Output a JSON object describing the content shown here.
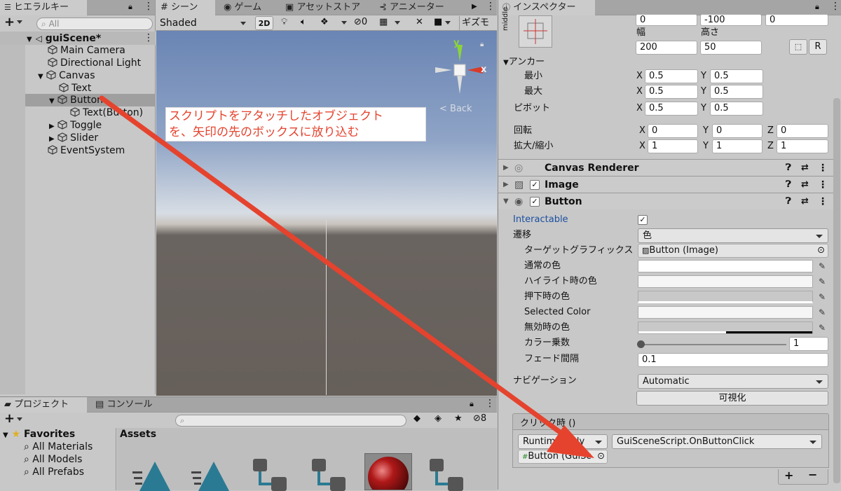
{
  "hierarchy": {
    "tab_label": "ヒエラルキー",
    "search_placeholder": "All",
    "items": [
      {
        "label": "guiScene*"
      },
      {
        "label": "Main Camera"
      },
      {
        "label": "Directional Light"
      },
      {
        "label": "Canvas"
      },
      {
        "label": "Text"
      },
      {
        "label": "Button"
      },
      {
        "label": "Text(Button)"
      },
      {
        "label": "Toggle"
      },
      {
        "label": "Slider"
      },
      {
        "label": "EventSystem"
      }
    ]
  },
  "scene": {
    "tabs": [
      {
        "label": "シーン"
      },
      {
        "label": "ゲーム"
      },
      {
        "label": "アセットストア"
      },
      {
        "label": "アニメーター"
      }
    ],
    "shading_mode": "Shaded",
    "mode_2d": "2D",
    "hidden_count": "0",
    "gizmos_label": "ギズモ",
    "gizmo_y": "y",
    "gizmo_x": "x",
    "back_label": "< Back",
    "callout_line1": "スクリプトをアタッチしたオブジェクト",
    "callout_line2": "を、矢印の先のボックスに放り込む",
    "callout_color": "#e5432e",
    "sky_color": "#6a85b4",
    "ground_color": "#6a6460"
  },
  "project": {
    "tabs": [
      {
        "label": "プロジェクト"
      },
      {
        "label": "コンソール"
      }
    ],
    "favorites_label": "Favorites",
    "favorites": [
      {
        "label": "All Materials"
      },
      {
        "label": "All Models"
      },
      {
        "label": "All Prefabs"
      }
    ],
    "assets_label": "Assets",
    "hidden_count": "8"
  },
  "inspector": {
    "tab_label": "インスペクター",
    "rect": {
      "anchor_preset_label": "middle",
      "pos": [
        "0",
        "-100",
        "0"
      ],
      "width_label": "幅",
      "height_label": "高さ",
      "width": "200",
      "height": "50",
      "r_label": "R"
    },
    "anchor_label": "アンカー",
    "min_label": "最小",
    "max_label": "最大",
    "pivot_label": "ピボット",
    "rotation_label": "回転",
    "scale_label": "拡大/縮小",
    "axis_x": "X",
    "axis_y": "Y",
    "axis_z": "Z",
    "anchor_min": [
      "0.5",
      "0.5"
    ],
    "anchor_max": [
      "0.5",
      "0.5"
    ],
    "pivot": [
      "0.5",
      "0.5"
    ],
    "rotation": [
      "0",
      "0",
      "0"
    ],
    "scale": [
      "1",
      "1",
      "1"
    ],
    "components": [
      {
        "label": "Canvas Renderer"
      },
      {
        "label": "Image"
      },
      {
        "label": "Button"
      }
    ],
    "button": {
      "interactable_label": "Interactable",
      "transition_label": "遷移",
      "transition_value": "色",
      "target_graphic_label": "ターゲットグラフィックス",
      "target_graphic_value": "Button (Image)",
      "normal_color_label": "通常の色",
      "highlight_color_label": "ハイライト時の色",
      "pressed_color_label": "押下時の色",
      "selected_color_label": "Selected Color",
      "disabled_color_label": "無効時の色",
      "multiplier_label": "カラー乗数",
      "multiplier_value": "1",
      "multiplier_fraction": 0.0,
      "fade_label": "フェード間隔",
      "fade_value": "0.1",
      "navigation_label": "ナビゲーション",
      "navigation_value": "Automatic",
      "visualize_label": "可視化",
      "onclick_label": "クリック時 ()",
      "runtime_value": "Runtime Only",
      "function_value": "GuiSceneScript.OnButtonClick",
      "object_value": "Button (GuiSc"
    }
  }
}
